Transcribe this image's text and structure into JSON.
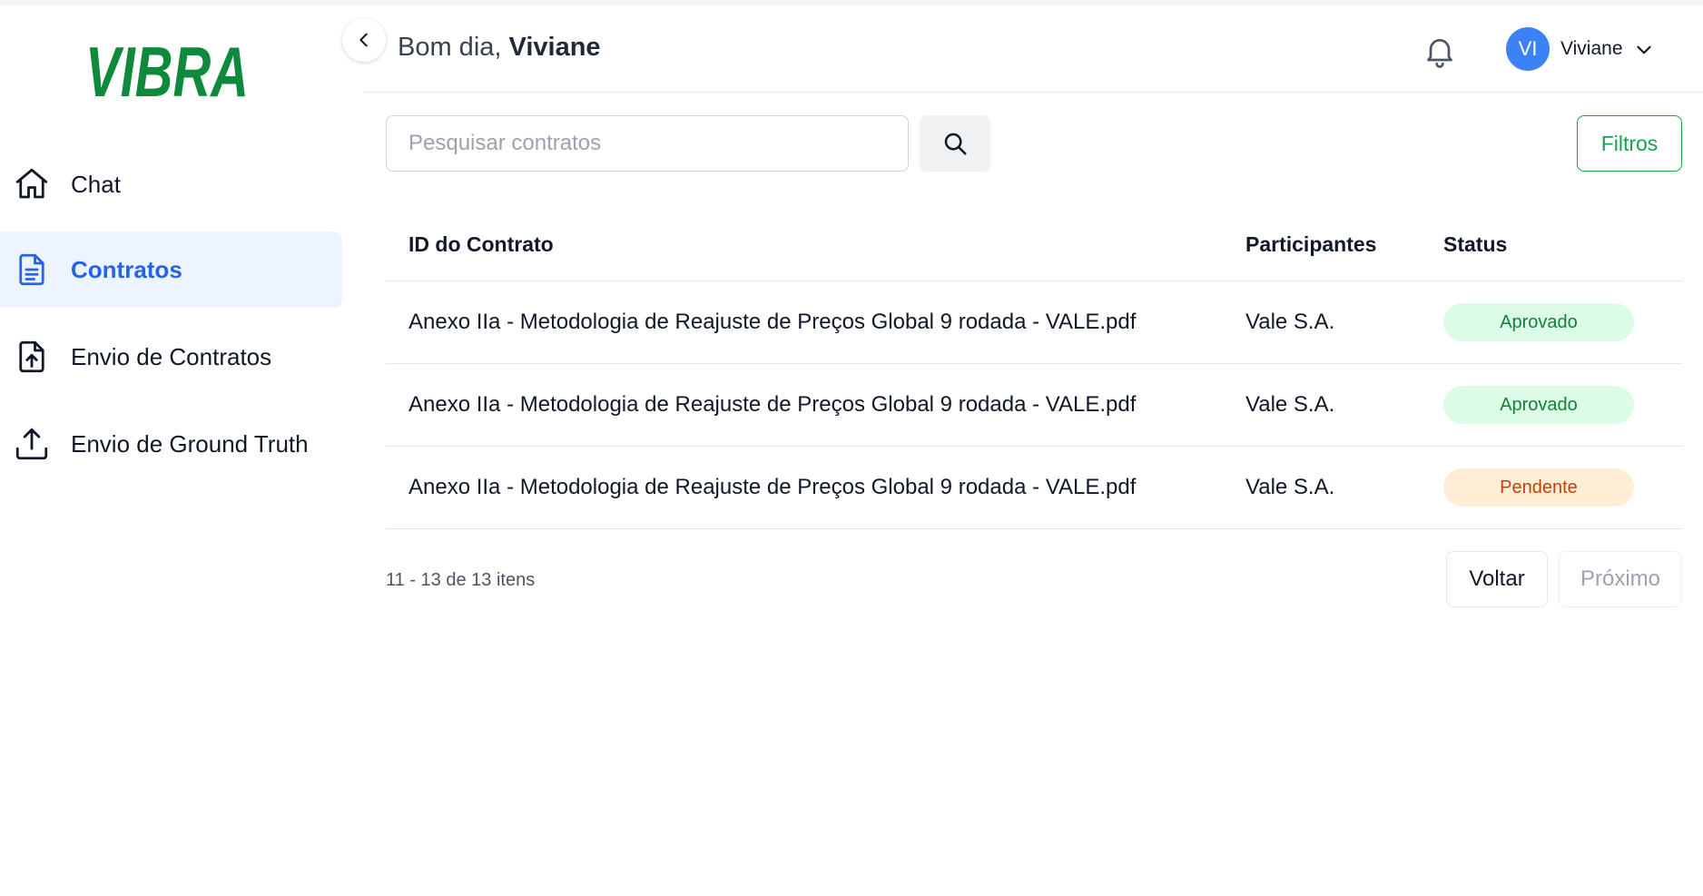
{
  "brand": {
    "logo_text": "VIBRA",
    "color": "#0f8a3c"
  },
  "colors": {
    "accent": "#2563eb",
    "active_bg": "#eef4ff",
    "approved_bg": "#dcfce7",
    "approved_text": "#15803d",
    "pending_bg": "#ffedd5",
    "pending_text": "#c2410c",
    "filters": "#16a34a"
  },
  "sidebar": {
    "items": [
      {
        "label": "Chat",
        "icon": "home-icon",
        "active": false
      },
      {
        "label": "Contratos",
        "icon": "document-icon",
        "active": true
      },
      {
        "label": "Envio de Contratos",
        "icon": "file-upload-icon",
        "active": false
      },
      {
        "label": "Envio de Ground Truth",
        "icon": "upload-icon",
        "active": false
      }
    ]
  },
  "header": {
    "greeting_prefix": "Bom dia,",
    "greeting_name": "Viviane",
    "notifications_icon": "bell-icon",
    "user": {
      "initials": "VI",
      "name": "Viviane"
    }
  },
  "search": {
    "placeholder": "Pesquisar contratos",
    "value": ""
  },
  "filters_label": "Filtros",
  "table": {
    "columns": [
      "ID do Contrato",
      "Participantes",
      "Status"
    ],
    "rows": [
      {
        "id": "Anexo IIa - Metodologia de Reajuste de Preços Global 9 rodada - VALE.pdf",
        "participants": "Vale S.A.",
        "status": "Aprovado",
        "status_type": "approved"
      },
      {
        "id": "Anexo IIa - Metodologia de Reajuste de Preços Global 9 rodada - VALE.pdf",
        "participants": "Vale S.A.",
        "status": "Aprovado",
        "status_type": "approved"
      },
      {
        "id": "Anexo IIa - Metodologia de Reajuste de Preços Global 9 rodada - VALE.pdf",
        "participants": "Vale S.A.",
        "status": "Pendente",
        "status_type": "pending"
      }
    ]
  },
  "pagination": {
    "info": "11 - 13 de 13 itens",
    "back_label": "Voltar",
    "next_label": "Próximo"
  }
}
